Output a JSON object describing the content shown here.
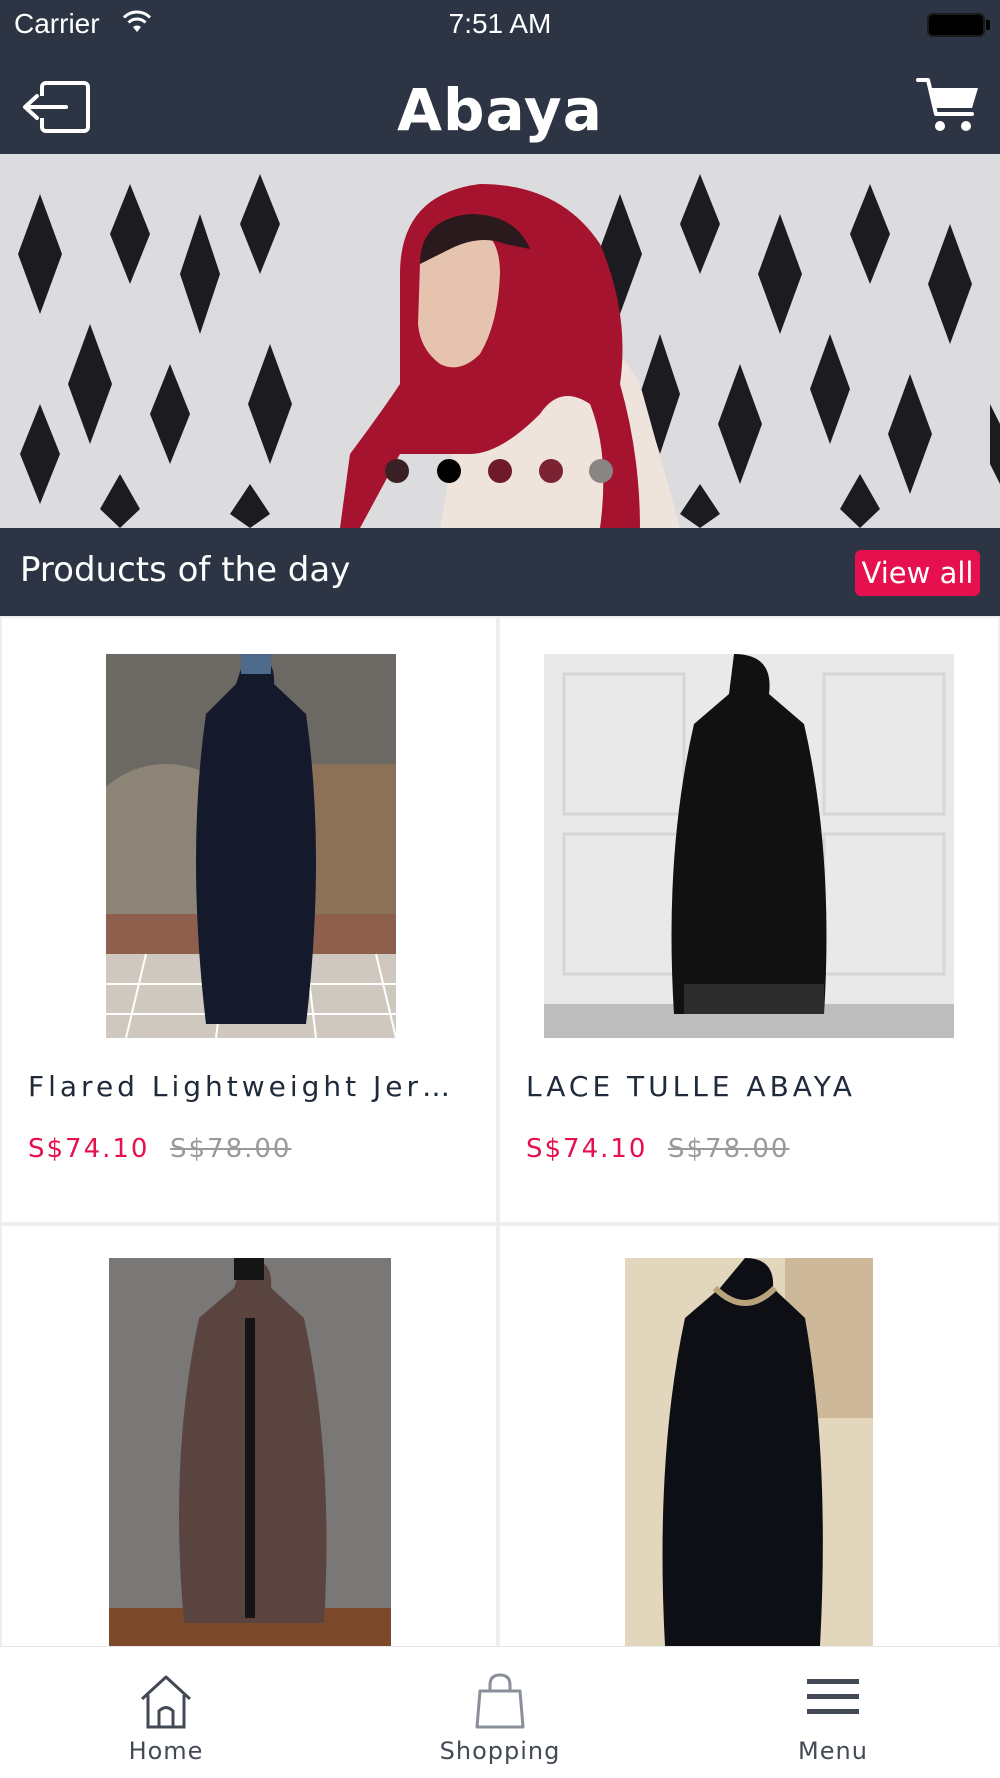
{
  "status_bar": {
    "carrier": "Carrier",
    "time": "7:51 AM"
  },
  "nav": {
    "title": "Abaya",
    "logout_icon": "logout-icon",
    "cart_icon": "cart-icon"
  },
  "banner": {
    "slide_count": 5,
    "active_slide": 2
  },
  "section": {
    "title": "Products of the day",
    "view_all_label": "View all"
  },
  "products": [
    {
      "name": "Flared Lightweight Jers...",
      "price": "S$74.10",
      "old_price": "S$78.00"
    },
    {
      "name": "LACE TULLE ABAYA",
      "price": "S$74.10",
      "old_price": "S$78.00"
    },
    {
      "name": "",
      "price": "",
      "old_price": ""
    },
    {
      "name": "",
      "price": "",
      "old_price": ""
    }
  ],
  "tabs": [
    {
      "label": "Home",
      "icon": "home-icon"
    },
    {
      "label": "Shopping",
      "icon": "shopping-bag-icon"
    },
    {
      "label": "Menu",
      "icon": "menu-icon"
    }
  ],
  "colors": {
    "header": "#2d3545",
    "accent": "#e5104d",
    "text": "#1f2a3a",
    "muted": "#9a9a9a"
  }
}
